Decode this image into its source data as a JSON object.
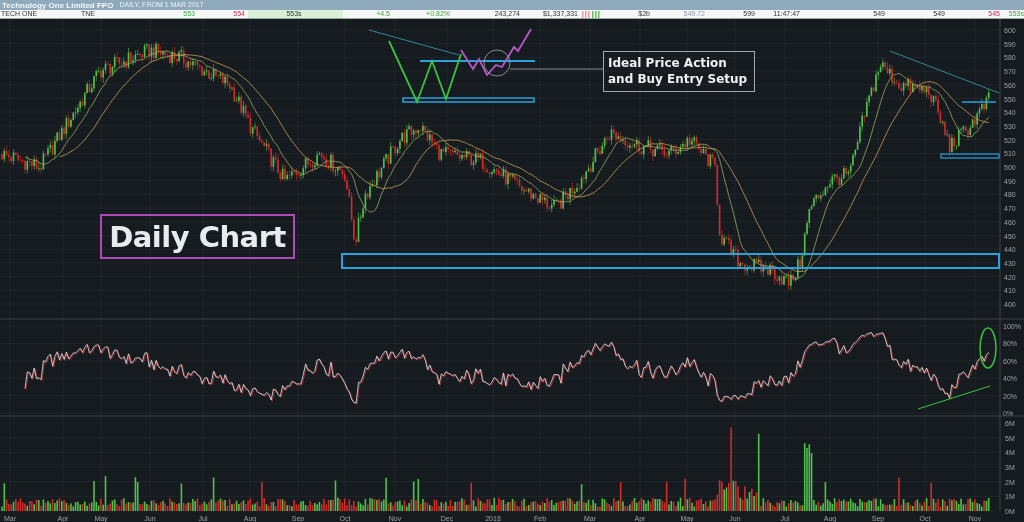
{
  "header": {
    "title": "Technology One Limited FPO",
    "subtitle": "DAILY, FROM 1 MAR 2017"
  },
  "quote": [
    {
      "kind": "text",
      "text": "TECH ONE",
      "up": false,
      "down": false,
      "dimmed": false,
      "highlighted": false
    },
    {
      "kind": "text",
      "text": "TNE",
      "up": false,
      "down": false,
      "dimmed": false,
      "highlighted": false
    },
    {
      "kind": "text",
      "text": "553",
      "up": true,
      "down": false,
      "dimmed": false,
      "highlighted": false
    },
    {
      "kind": "text",
      "text": "554",
      "up": false,
      "down": true,
      "dimmed": false,
      "highlighted": false
    },
    {
      "kind": "text",
      "text": "553s",
      "up": false,
      "down": false,
      "dimmed": false,
      "highlighted": true
    },
    {
      "kind": "text",
      "text": "+4.5",
      "up": true,
      "down": false,
      "dimmed": false,
      "highlighted": false
    },
    {
      "kind": "text",
      "text": "+0.82%",
      "up": true,
      "down": false,
      "dimmed": false,
      "highlighted": false
    },
    {
      "kind": "text",
      "text": "243,274",
      "up": false,
      "down": false,
      "dimmed": false,
      "highlighted": false
    },
    {
      "kind": "text",
      "text": "$1,337,331",
      "up": false,
      "down": false,
      "dimmed": false,
      "highlighted": false
    },
    {
      "kind": "bars"
    },
    {
      "kind": "text",
      "text": "$2b",
      "up": false,
      "down": false,
      "dimmed": false,
      "highlighted": false
    },
    {
      "kind": "text",
      "text": "549.72",
      "up": false,
      "down": false,
      "dimmed": true,
      "highlighted": false
    },
    {
      "kind": "text",
      "text": "599",
      "up": false,
      "down": false,
      "dimmed": false,
      "highlighted": false
    },
    {
      "kind": "text",
      "text": "11:47:47",
      "up": false,
      "down": false,
      "dimmed": false,
      "highlighted": false
    },
    {
      "kind": "text",
      "text": "549",
      "up": false,
      "down": false,
      "dimmed": false,
      "highlighted": false
    },
    {
      "kind": "text",
      "text": "549",
      "up": false,
      "down": false,
      "dimmed": false,
      "highlighted": false
    },
    {
      "kind": "text",
      "text": "545",
      "up": false,
      "down": true,
      "dimmed": false,
      "highlighted": false
    },
    {
      "kind": "text",
      "text": "553s",
      "up": true,
      "down": false,
      "dimmed": false,
      "highlighted": false
    }
  ],
  "price_axis": [
    "600",
    "590",
    "580",
    "570",
    "560",
    "550",
    "540",
    "530",
    "520",
    "510",
    "500",
    "490",
    "480",
    "470",
    "460",
    "450",
    "440",
    "430",
    "420",
    "410",
    "400"
  ],
  "rsi_axis": [
    "100%",
    "80%",
    "60%",
    "40%",
    "20%",
    "0%"
  ],
  "volume_axis": [
    "6M",
    "5M",
    "4M",
    "3M",
    "2M",
    "1M",
    "0M"
  ],
  "months": [
    "Mar",
    "Apr",
    "May",
    "Jun",
    "Jul",
    "Aug",
    "Sep",
    "Oct",
    "Nov",
    "Dec",
    "2018",
    "Feb",
    "Mar",
    "Apr",
    "May",
    "Jun",
    "Jul",
    "Aug",
    "Sep",
    "Oct",
    "Nov"
  ],
  "annotations": {
    "label": "Daily Chart",
    "callout": "Ideal Price Action and Buy Entry Setup"
  }
}
